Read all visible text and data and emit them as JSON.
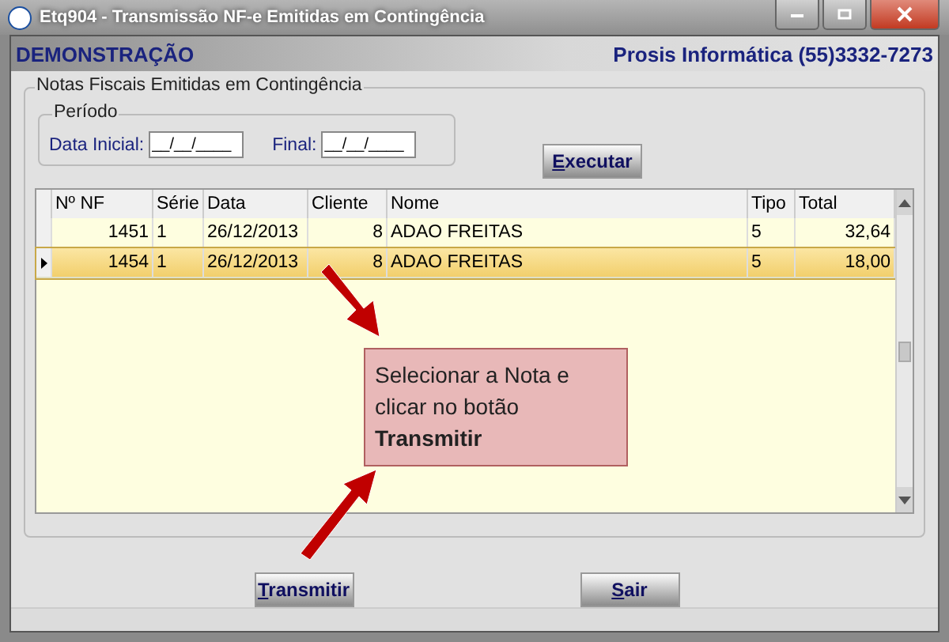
{
  "window": {
    "title": "Etq904 - Transmissão NF-e Emitidas em Contingência"
  },
  "header": {
    "left": "DEMONSTRAÇÃO",
    "right": "Prosis Informática (55)3332-7273"
  },
  "group": {
    "title": "Notas Fiscais Emitidas em Contingência",
    "period": {
      "title": "Período",
      "fields": [
        {
          "label": "Data Inicial:",
          "value": "__/__/____"
        },
        {
          "label": "Final:",
          "value": "__/__/____"
        }
      ]
    },
    "run_button": "Executar"
  },
  "table": {
    "columns": [
      "Nº NF",
      "Série",
      "Data",
      "Cliente",
      "Nome",
      "Tipo",
      "Total"
    ],
    "rows": [
      {
        "selected": false,
        "cells": [
          "1451",
          "1",
          "26/12/2013",
          "8",
          "ADAO FREITAS",
          "5",
          "32,64"
        ]
      },
      {
        "selected": true,
        "cells": [
          "1454",
          "1",
          "26/12/2013",
          "8",
          "ADAO FREITAS",
          "5",
          "18,00"
        ]
      }
    ]
  },
  "callout": "Selecionar a Nota e clicar no botão **Transmitir**",
  "buttons": [
    "Transmitir",
    "Sair"
  ]
}
